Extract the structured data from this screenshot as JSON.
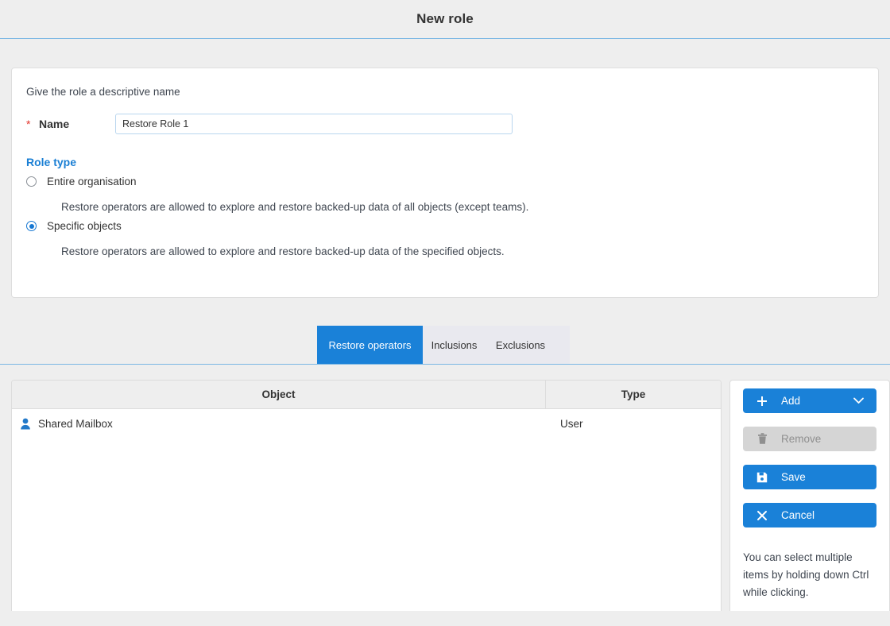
{
  "window": {
    "title": "New role"
  },
  "form": {
    "hint": "Give the role a descriptive name",
    "required_marker": "*",
    "name_label": "Name",
    "name_value": "Restore Role 1",
    "name_placeholder": "",
    "role_type_title": "Role type",
    "role_type_options": [
      {
        "label": "Entire organisation",
        "description": "Restore operators are allowed to explore and restore backed-up data of all objects (except teams).",
        "selected": false
      },
      {
        "label": "Specific objects",
        "description": "Restore operators are allowed to explore and restore backed-up data of the specified objects.",
        "selected": true
      }
    ]
  },
  "tabs": [
    {
      "label": "Restore operators",
      "active": true
    },
    {
      "label": "Inclusions",
      "active": false
    },
    {
      "label": "Exclusions",
      "active": false
    }
  ],
  "table": {
    "columns": [
      "Object",
      "Type"
    ],
    "rows": [
      {
        "icon": "user-icon",
        "object": "Shared Mailbox",
        "type": "User"
      }
    ]
  },
  "actions": {
    "add_label": "Add",
    "add_icon": "plus-icon",
    "add_dropdown_icon": "chevron-down-icon",
    "remove_label": "Remove",
    "remove_icon": "trash-icon",
    "remove_disabled": true,
    "save_label": "Save",
    "save_icon": "floppy-disk-icon",
    "cancel_label": "Cancel",
    "cancel_icon": "close-x-icon",
    "help_text": "You can select multiple items by holding down Ctrl while clicking."
  },
  "colors": {
    "accent_blue": "#1a81d8",
    "link_blue": "#1a7fd4",
    "page_bg": "#eeeeee",
    "required_red": "#e2322a",
    "disabled_gray": "#d5d5d5"
  }
}
